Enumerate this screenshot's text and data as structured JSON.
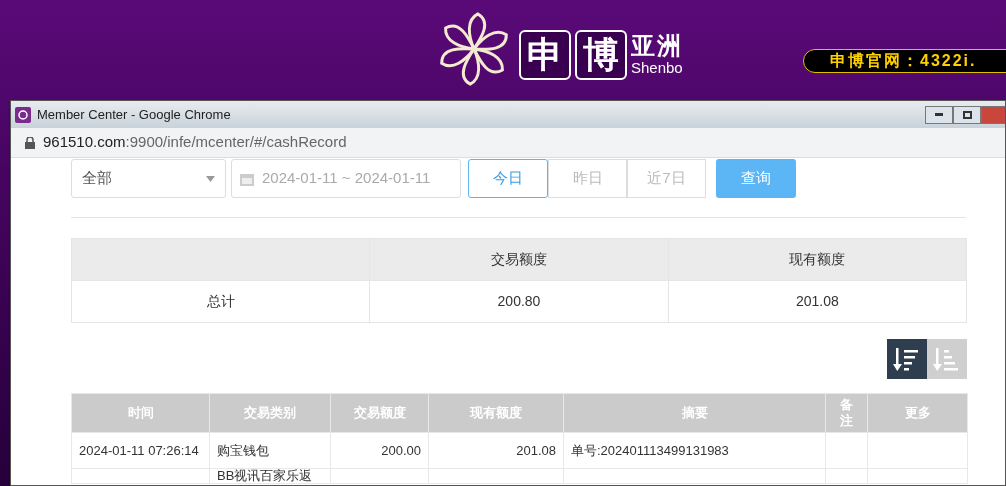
{
  "site_header": {
    "logo_cn_chars": [
      "申",
      "博"
    ],
    "logo_cn_suffix": "亚洲",
    "logo_en": "Shenbo",
    "ticker": "申博官网：4322i."
  },
  "window": {
    "title": "Member Center - Google Chrome",
    "url_host": "961510.com",
    "url_rest": ":9900/infe/mcenter/#/cashRecord"
  },
  "filters": {
    "category": "全部",
    "date_range": "2024-01-11 ~ 2024-01-11",
    "quick_ranges": [
      {
        "label": "今日",
        "selected": true
      },
      {
        "label": "昨日",
        "selected": false
      },
      {
        "label": "近7日",
        "selected": false
      }
    ],
    "query_button": "查询"
  },
  "summary": {
    "columns": [
      "交易额度",
      "现有额度"
    ],
    "rows": [
      {
        "label": "总计",
        "values": [
          "200.80",
          "201.08"
        ]
      }
    ]
  },
  "sort_buttons": [
    {
      "kind": "descending",
      "selected": true
    },
    {
      "kind": "ascending",
      "selected": false
    }
  ],
  "table": {
    "columns": [
      "时间",
      "交易类别",
      "交易额度",
      "现有额度",
      "摘要",
      "备注",
      "更多"
    ],
    "rows": [
      [
        "2024-01-11 07:26:14",
        "购宝钱包",
        "200.00",
        "201.08",
        "单号:202401113499131983",
        "",
        ""
      ],
      [
        "",
        "BB视讯百家乐返",
        "",
        "",
        "",
        "",
        ""
      ]
    ]
  }
}
